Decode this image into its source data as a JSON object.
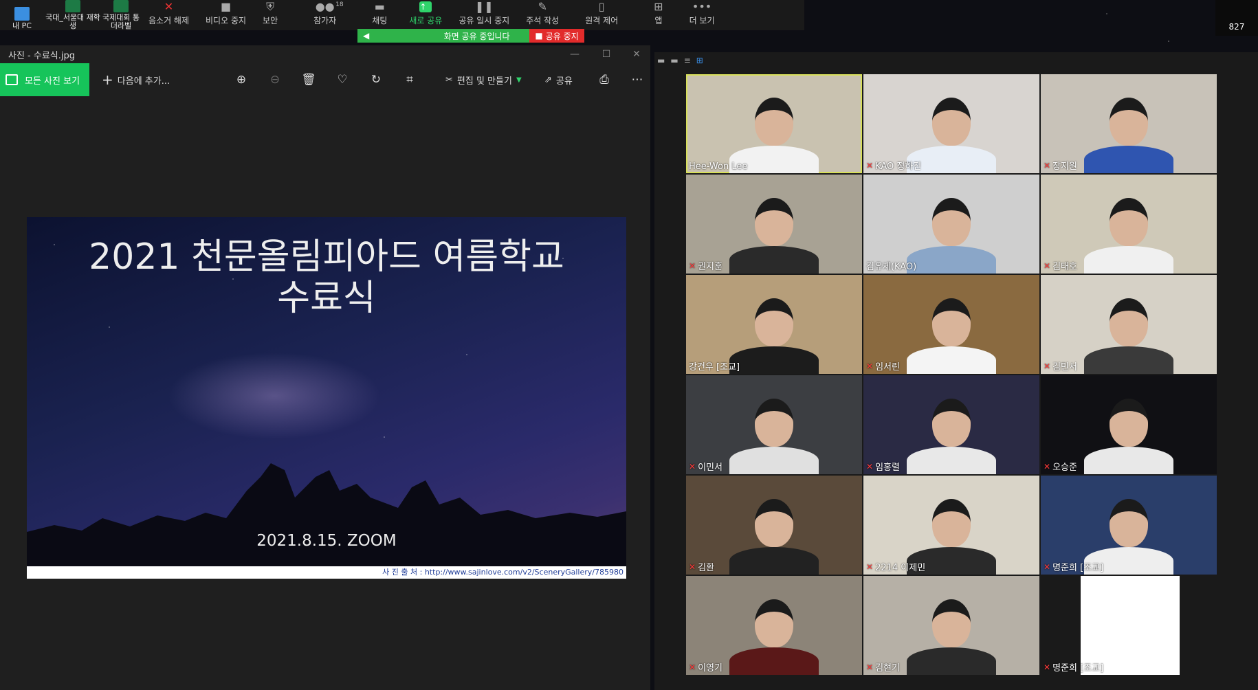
{
  "desktop": {
    "icons": [
      {
        "label": "내 PC"
      },
      {
        "label": "국대_서울대 재학생"
      },
      {
        "label": "국제대회 통더라벨"
      }
    ]
  },
  "toolbar": {
    "buttons": [
      {
        "label": "음소거 해제",
        "icon": "mic-off-icon"
      },
      {
        "label": "비디오 중지",
        "icon": "video-icon"
      },
      {
        "label": "보안",
        "icon": "shield-icon"
      },
      {
        "label": "참가자",
        "icon": "participants-icon",
        "count": "18"
      },
      {
        "label": "채팅",
        "icon": "chat-icon"
      },
      {
        "label": "새로 공유",
        "icon": "share-icon"
      },
      {
        "label": "공유 일시 중지",
        "icon": "pause-icon"
      },
      {
        "label": "주석 작성",
        "icon": "pen-icon"
      },
      {
        "label": "원격 제어",
        "icon": "mouse-icon"
      },
      {
        "label": "앱",
        "icon": "apps-icon"
      },
      {
        "label": "더 보기",
        "icon": "more-icon"
      }
    ],
    "share_banner": "화면 공유 중입니다",
    "stop_share": "공유 중지"
  },
  "counter": "827",
  "photos": {
    "title": "사진 - 수료식.jpg",
    "all_photos": "모든 사진 보기",
    "add_to": "다음에 추가...",
    "edit_create": "편집 및 만들기",
    "share": "공유",
    "slide": {
      "title_line1": "2021 천문올림피아드 여름학교",
      "title_line2": "수료식",
      "date": "2021.8.15. ZOOM",
      "credit": "사 진 출 처 : http://www.sajinlove.com/v2/SceneryGallery/785980"
    }
  },
  "participants": [
    {
      "name": "Hee-Won Lee",
      "muted": false,
      "bg": "#c9c2b0",
      "shirt": "#f2f2f2",
      "active": true
    },
    {
      "name": "KAO 정하진",
      "muted": true,
      "bg": "#d8d4d0",
      "shirt": "#e8eef6"
    },
    {
      "name": "장지원",
      "muted": true,
      "bg": "#c8c2b8",
      "shirt": "#2f55b0"
    },
    {
      "name": "권지훈",
      "muted": true,
      "bg": "#a8a294",
      "shirt": "#2a2a2a"
    },
    {
      "name": "김유제(KAO)",
      "muted": false,
      "bg": "#cfcfcf",
      "shirt": "#8aa6c8"
    },
    {
      "name": "김태호",
      "muted": true,
      "bg": "#cfc9b8",
      "shirt": "#f0f0f0"
    },
    {
      "name": "강건우 [조교]",
      "muted": false,
      "bg": "#b69e7a",
      "shirt": "#1c1c1c"
    },
    {
      "name": "임서린",
      "muted": true,
      "bg": "#8a6a40",
      "shirt": "#f4f4f4"
    },
    {
      "name": "김민서",
      "muted": true,
      "bg": "#d6d1c6",
      "shirt": "#3a3a3a"
    },
    {
      "name": "이민서",
      "muted": true,
      "bg": "#3c3e42",
      "shirt": "#e0e0e0"
    },
    {
      "name": "임홍렬",
      "muted": true,
      "bg": "#2a2a44",
      "shirt": "#e8e8e8"
    },
    {
      "name": "오승준",
      "muted": true,
      "bg": "#101014",
      "shirt": "#e8e8e8"
    },
    {
      "name": "김환",
      "muted": true,
      "bg": "#5a4a3a",
      "shirt": "#222222"
    },
    {
      "name": "2214 이제민",
      "muted": true,
      "bg": "#d9d4c8",
      "shirt": "#2a2a2a"
    },
    {
      "name": "명준희 [조교]",
      "muted": true,
      "bg": "#2a3e6a",
      "shirt": "#eeeeee"
    },
    {
      "name": "이영기",
      "muted": true,
      "bg": "#8c8478",
      "shirt": "#5a1818"
    },
    {
      "name": "김현기",
      "muted": true,
      "bg": "#b6b0a6",
      "shirt": "#2a2a2a"
    },
    {
      "name": "명준희 [조교]",
      "muted": true,
      "bg": "#ffffff",
      "shirt": "",
      "blank": true
    }
  ]
}
